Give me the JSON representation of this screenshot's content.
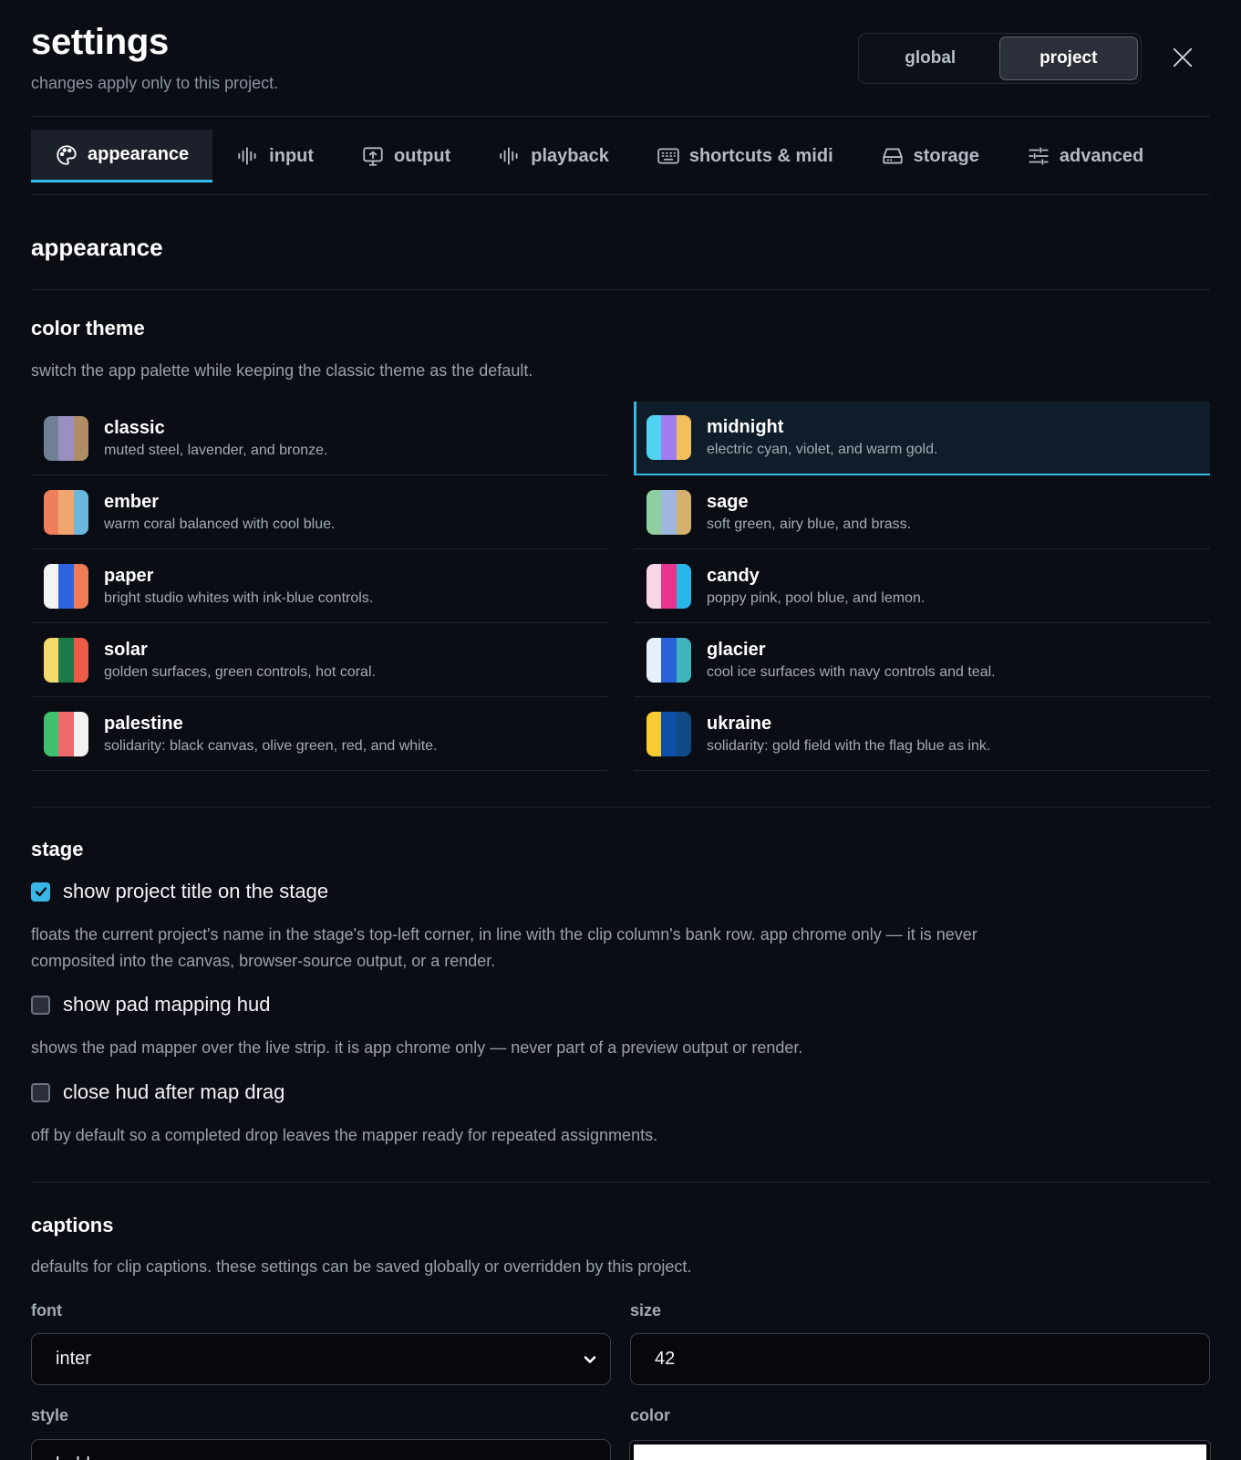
{
  "header": {
    "title": "settings",
    "subtitle": "changes apply only to this project.",
    "scope": {
      "global": "global",
      "project": "project",
      "selected": "project"
    }
  },
  "tabs": [
    {
      "label": "appearance",
      "icon": "palette-icon",
      "active": true
    },
    {
      "label": "input",
      "icon": "waveform-icon",
      "active": false
    },
    {
      "label": "output",
      "icon": "monitor-upload-icon",
      "active": false
    },
    {
      "label": "playback",
      "icon": "waveform-icon",
      "active": false
    },
    {
      "label": "shortcuts & midi",
      "icon": "keyboard-icon",
      "active": false
    },
    {
      "label": "storage",
      "icon": "drive-icon",
      "active": false
    },
    {
      "label": "advanced",
      "icon": "sliders-icon",
      "active": false
    }
  ],
  "section_title": "appearance",
  "color_theme": {
    "heading": "color theme",
    "description": "switch the app palette while keeping the classic theme as the default.",
    "selected": "midnight",
    "themes": [
      {
        "name": "classic",
        "desc": "muted steel, lavender, and bronze.",
        "colors": [
          "#6f7f94",
          "#9a8fc0",
          "#b08d64"
        ]
      },
      {
        "name": "midnight",
        "desc": "electric cyan, violet, and warm gold.",
        "colors": [
          "#4fd3ee",
          "#a07ef0",
          "#f1c05c"
        ]
      },
      {
        "name": "ember",
        "desc": "warm coral balanced with cool blue.",
        "colors": [
          "#ef7e5c",
          "#f0a66f",
          "#6bb7dd"
        ]
      },
      {
        "name": "sage",
        "desc": "soft green, airy blue, and brass.",
        "colors": [
          "#8fcf9f",
          "#9fb7e0",
          "#d4b06c"
        ]
      },
      {
        "name": "paper",
        "desc": "bright studio whites with ink-blue controls.",
        "colors": [
          "#f4f4f2",
          "#2e63e0",
          "#f07b56"
        ]
      },
      {
        "name": "candy",
        "desc": "poppy pink, pool blue, and lemon.",
        "colors": [
          "#f7d6e8",
          "#e8338f",
          "#29b6e8"
        ]
      },
      {
        "name": "solar",
        "desc": "golden surfaces, green controls, hot coral.",
        "colors": [
          "#f4da6c",
          "#1b7a4a",
          "#ef5a47"
        ]
      },
      {
        "name": "glacier",
        "desc": "cool ice surfaces with navy controls and teal.",
        "colors": [
          "#e6f0fb",
          "#2a62d9",
          "#3fb4be"
        ]
      },
      {
        "name": "palestine",
        "desc": "solidarity: black canvas, olive green, red, and white.",
        "colors": [
          "#3fbf6f",
          "#f0696a",
          "#f2f2f2"
        ]
      },
      {
        "name": "ukraine",
        "desc": "solidarity: gold field with the flag blue as ink.",
        "colors": [
          "#f6cc32",
          "#0e4fa8",
          "#114a86"
        ]
      }
    ]
  },
  "stage": {
    "heading": "stage",
    "options": [
      {
        "label": "show project title on the stage",
        "checked": true,
        "desc": "floats the current project's name in the stage's top-left corner, in line with the clip column's bank row. app chrome only — it is never composited into the canvas, browser-source output, or a render."
      },
      {
        "label": "show pad mapping hud",
        "checked": false,
        "desc": "shows the pad mapper over the live strip. it is app chrome only — never part of a preview output or render."
      },
      {
        "label": "close hud after map drag",
        "checked": false,
        "desc": "off by default so a completed drop leaves the mapper ready for repeated assignments."
      }
    ]
  },
  "captions": {
    "heading": "captions",
    "description": "defaults for clip captions. these settings can be saved globally or overridden by this project.",
    "font_label": "font",
    "font_value": "inter",
    "size_label": "size",
    "size_value": "42",
    "style_label": "style",
    "style_value": "bold",
    "color_label": "color",
    "color_value": "#ffffff"
  },
  "accent_color": "#35b9e9"
}
